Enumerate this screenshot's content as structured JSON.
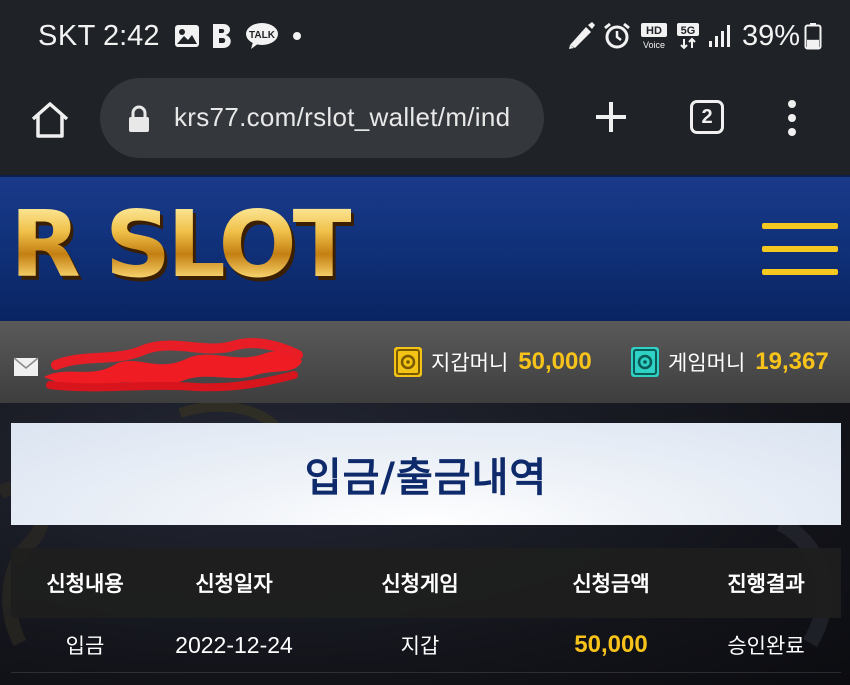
{
  "status_bar": {
    "carrier": "SKT",
    "time": "2:42",
    "notification_icons": [
      "gallery-icon",
      "b-app-icon",
      "kakaotalk-icon",
      "dot-icon"
    ],
    "talk_label": "TALK",
    "system_icons": [
      "stylus-icon",
      "alarm-icon",
      "hd-voice-icon",
      "5g-icon",
      "signal-icon"
    ],
    "hd_label": "HD",
    "voice_label": "Voice",
    "network_label": "5G",
    "battery_percent": "39%",
    "battery_level": 0.39
  },
  "browser": {
    "url": "krs77.com/rslot_wallet/m/ind",
    "tab_count": "2"
  },
  "site": {
    "logo_text": "R SLOT",
    "accent_color": "#f7c31a",
    "header_color": "#10317a"
  },
  "account": {
    "wallet_label": "지갑머니",
    "wallet_value": "50,000",
    "game_label": "게임머니",
    "game_value": "19,367"
  },
  "page": {
    "title": "입금/출금내역"
  },
  "table": {
    "headers": [
      "신청내용",
      "신청일자",
      "신청게임",
      "신청금액",
      "진행결과"
    ],
    "rows": [
      {
        "type": "입금",
        "date": "2022-12-24",
        "game": "지갑",
        "amount": "50,000",
        "result": "승인완료"
      }
    ]
  }
}
